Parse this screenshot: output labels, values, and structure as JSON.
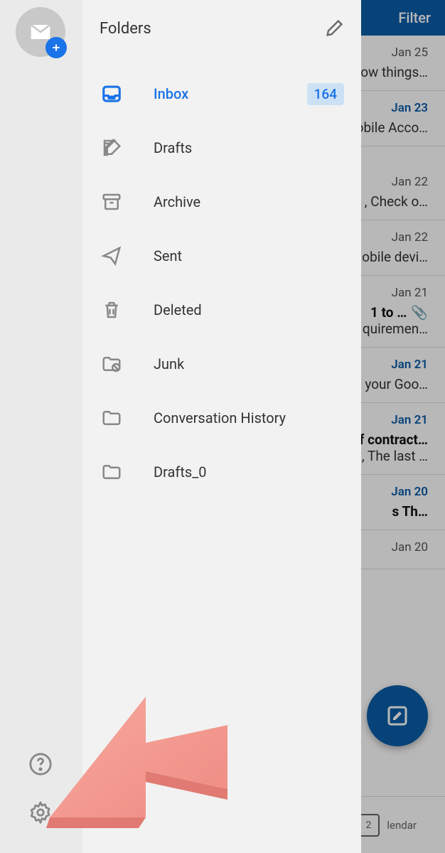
{
  "header": {
    "filter_label": "Filter"
  },
  "emails": [
    {
      "date": "Jan 25",
      "unread": false,
      "subject": "",
      "snippet": "ow things…"
    },
    {
      "date": "Jan 23",
      "unread": true,
      "subject": "",
      "snippet": "obile Acco…"
    },
    {
      "date": "Jan 22",
      "unread": false,
      "subject": "",
      "snippet": ", Check o…"
    },
    {
      "date": "Jan 22",
      "unread": false,
      "subject": "",
      "snippet": "obile devi…"
    },
    {
      "date": "Jan 21",
      "unread": false,
      "subject": "1 to …",
      "snippet": "quiremen…",
      "attachment": true
    },
    {
      "date": "Jan 21",
      "unread": true,
      "subject": "",
      "snippet": "your Goo…"
    },
    {
      "date": "Jan 21",
      "unread": true,
      "subject": "f contract…",
      "snippet": ", The last …"
    },
    {
      "date": "Jan 20",
      "unread": true,
      "subject": "s Th…",
      "snippet": ""
    },
    {
      "date": "Jan 20",
      "unread": false,
      "subject": "",
      "snippet": ""
    }
  ],
  "bottom_nav": {
    "calendar_label": "lendar",
    "calendar_day": "2"
  },
  "drawer": {
    "title": "Folders",
    "folders": [
      {
        "label": "Inbox",
        "badge": "164",
        "active": true
      },
      {
        "label": "Drafts"
      },
      {
        "label": "Archive"
      },
      {
        "label": "Sent"
      },
      {
        "label": "Deleted"
      },
      {
        "label": "Junk"
      },
      {
        "label": "Conversation History"
      },
      {
        "label": "Drafts_0"
      }
    ]
  }
}
